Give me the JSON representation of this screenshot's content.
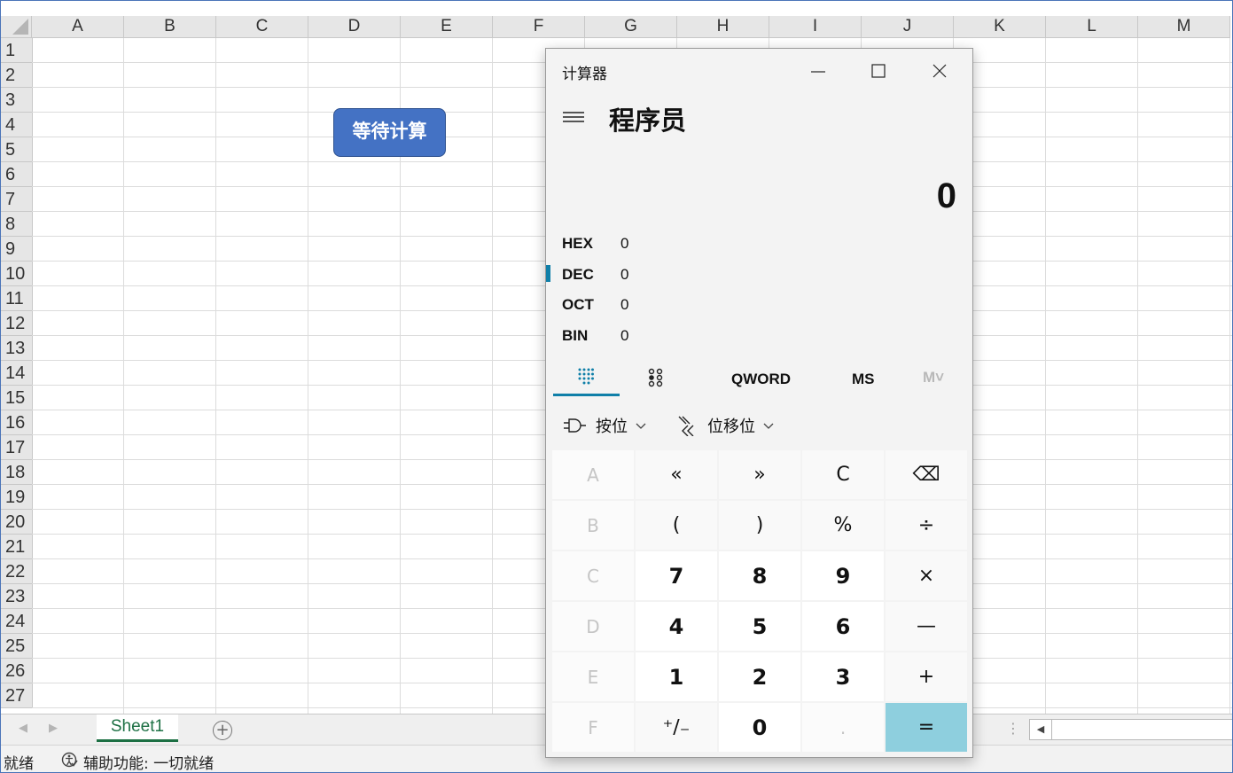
{
  "sheet": {
    "columns": [
      "A",
      "B",
      "C",
      "D",
      "E",
      "F",
      "G",
      "H",
      "I",
      "J",
      "K",
      "L",
      "M"
    ],
    "rows": [
      "1",
      "2",
      "3",
      "4",
      "5",
      "6",
      "7",
      "8",
      "9",
      "10",
      "11",
      "12",
      "13",
      "14",
      "15",
      "16",
      "17",
      "18",
      "19",
      "20",
      "21",
      "22",
      "23",
      "24",
      "25",
      "26",
      "27"
    ],
    "button_label": "等待计算",
    "tab_name": "Sheet1"
  },
  "status": {
    "ready": "就绪",
    "accessibility": "辅助功能: 一切就绪"
  },
  "calculator": {
    "window_title": "计算器",
    "mode": "程序员",
    "display": "0",
    "radix": [
      {
        "label": "HEX",
        "value": "0"
      },
      {
        "label": "DEC",
        "value": "0"
      },
      {
        "label": "OCT",
        "value": "0"
      },
      {
        "label": "BIN",
        "value": "0"
      }
    ],
    "selected_radix": "DEC",
    "word_size": "QWORD",
    "memory_store": "MS",
    "memory_recall": "M˅",
    "bitwise_label": "按位",
    "bitshift_label": "位移位",
    "keys": [
      {
        "label": "A",
        "kind": "dis",
        "name": "key-a"
      },
      {
        "label": "«",
        "kind": "op",
        "name": "key-left-shift"
      },
      {
        "label": "»",
        "kind": "op",
        "name": "key-right-shift"
      },
      {
        "label": "C",
        "kind": "op",
        "name": "key-clear"
      },
      {
        "label": "⌫",
        "kind": "op",
        "name": "key-backspace"
      },
      {
        "label": "B",
        "kind": "dis",
        "name": "key-b"
      },
      {
        "label": "(",
        "kind": "op",
        "name": "key-open-paren"
      },
      {
        "label": ")",
        "kind": "op",
        "name": "key-close-paren"
      },
      {
        "label": "%",
        "kind": "op",
        "name": "key-percent"
      },
      {
        "label": "÷",
        "kind": "op",
        "name": "key-divide"
      },
      {
        "label": "C",
        "kind": "dis",
        "name": "key-c-hex"
      },
      {
        "label": "7",
        "kind": "num",
        "name": "key-7"
      },
      {
        "label": "8",
        "kind": "num",
        "name": "key-8"
      },
      {
        "label": "9",
        "kind": "num",
        "name": "key-9"
      },
      {
        "label": "×",
        "kind": "op",
        "name": "key-multiply"
      },
      {
        "label": "D",
        "kind": "dis",
        "name": "key-d"
      },
      {
        "label": "4",
        "kind": "num",
        "name": "key-4"
      },
      {
        "label": "5",
        "kind": "num",
        "name": "key-5"
      },
      {
        "label": "6",
        "kind": "num",
        "name": "key-6"
      },
      {
        "label": "—",
        "kind": "op",
        "name": "key-subtract"
      },
      {
        "label": "E",
        "kind": "dis",
        "name": "key-e"
      },
      {
        "label": "1",
        "kind": "num",
        "name": "key-1"
      },
      {
        "label": "2",
        "kind": "num",
        "name": "key-2"
      },
      {
        "label": "3",
        "kind": "num",
        "name": "key-3"
      },
      {
        "label": "+",
        "kind": "op",
        "name": "key-add"
      },
      {
        "label": "F",
        "kind": "dis",
        "name": "key-f"
      },
      {
        "label": "⁺∕₋",
        "kind": "op",
        "name": "key-negate"
      },
      {
        "label": "0",
        "kind": "num",
        "name": "key-0"
      },
      {
        "label": ".",
        "kind": "dis",
        "name": "key-decimal"
      },
      {
        "label": "=",
        "kind": "eq",
        "name": "key-equals"
      }
    ]
  },
  "colors": {
    "accent": "#0f7fa8",
    "equals_key": "#8ecfde",
    "sheet_tab": "#1d7044",
    "shape_fill": "#4472c4"
  }
}
